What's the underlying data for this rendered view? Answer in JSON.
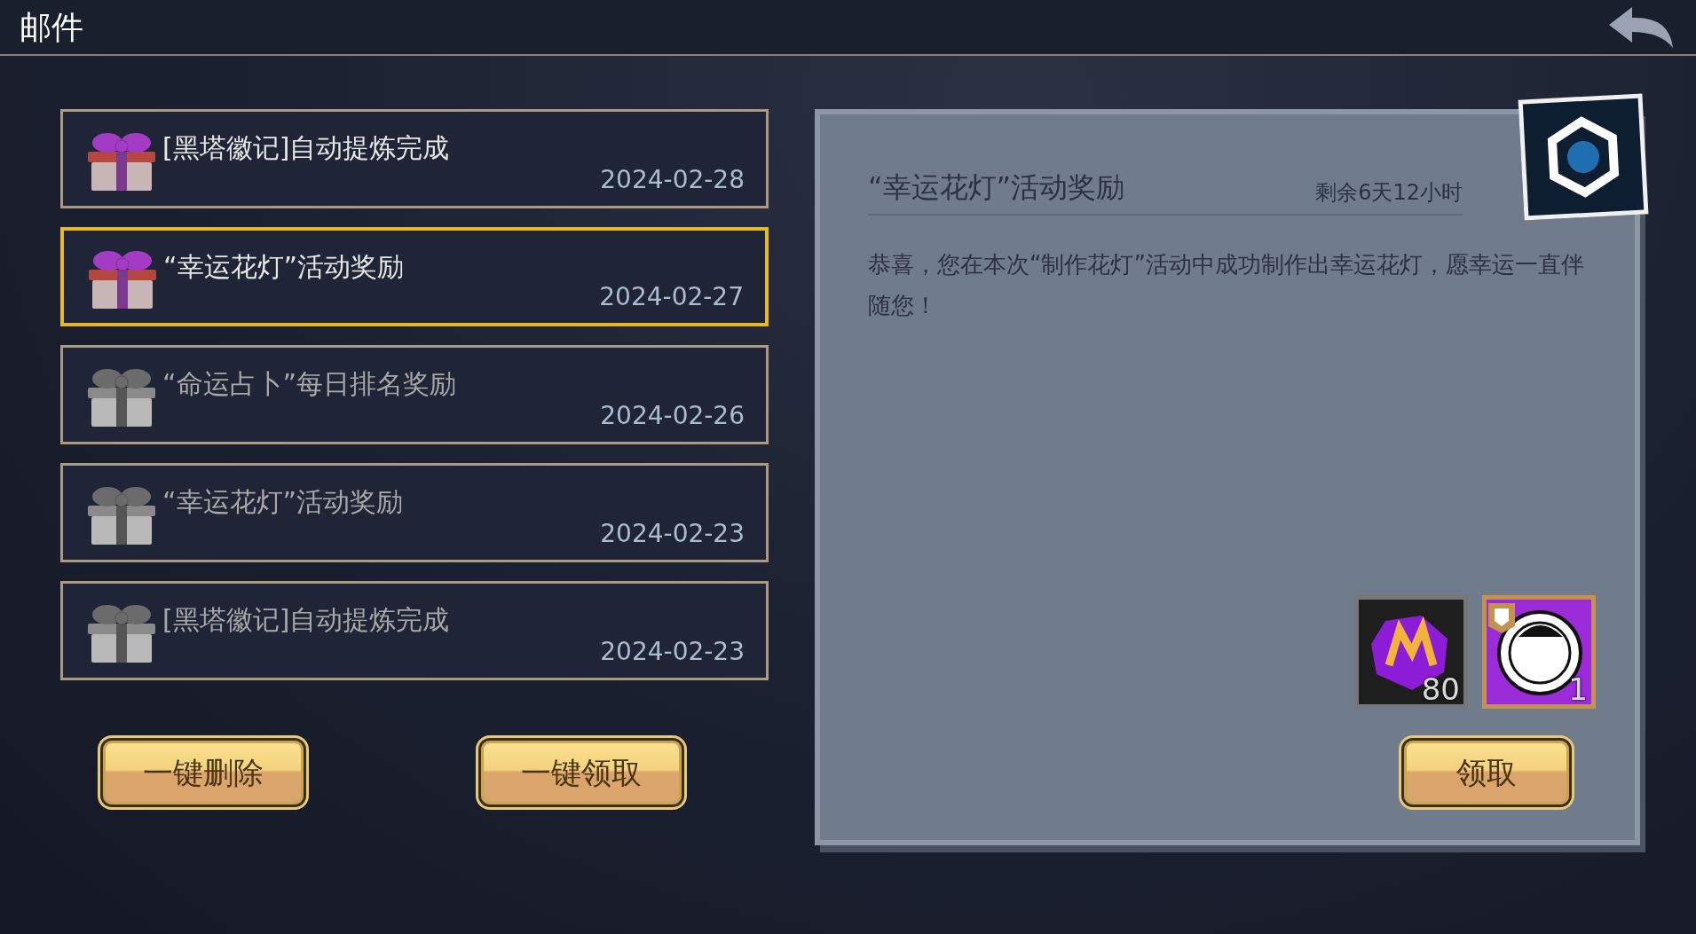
{
  "header": {
    "title": "邮件"
  },
  "mails": [
    {
      "title": "[黑塔徽记]自动提炼完成",
      "date": "2024-02-28",
      "read": false,
      "selected": false
    },
    {
      "title": "“幸运花灯”活动奖励",
      "date": "2024-02-27",
      "read": false,
      "selected": true
    },
    {
      "title": "“命运占卜”每日排名奖励",
      "date": "2024-02-26",
      "read": true,
      "selected": false
    },
    {
      "title": "“幸运花灯”活动奖励",
      "date": "2024-02-23",
      "read": true,
      "selected": false
    },
    {
      "title": "[黑塔徽记]自动提炼完成",
      "date": "2024-02-23",
      "read": true,
      "selected": false
    }
  ],
  "list_buttons": [
    "一键删除",
    "一键领取"
  ],
  "detail": {
    "title": "“幸运花灯”活动奖励",
    "remaining": "剩余6天12小时",
    "body": "恭喜，您在本次“制作花灯”活动中成功制作出幸运花灯，愿幸运一直伴随您！",
    "rewards": [
      {
        "kind": "gem",
        "count": "80"
      },
      {
        "kind": "emblem",
        "count": "1"
      }
    ],
    "claim_button": "领取"
  }
}
